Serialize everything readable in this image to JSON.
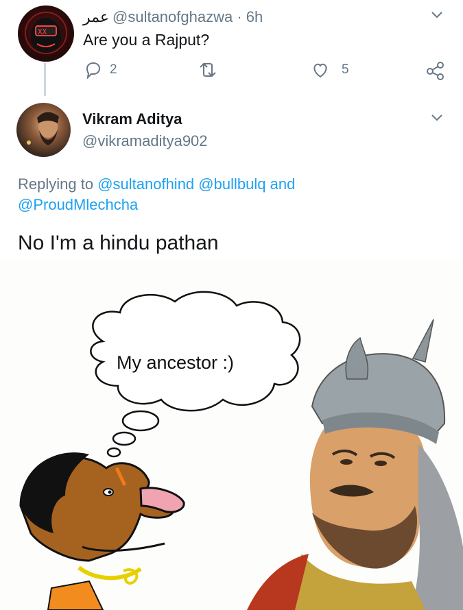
{
  "tweet1": {
    "display_name": "عمر",
    "handle_time": "@sultanofghazwa · 6h",
    "text": "Are you a Rajput?",
    "reply_count": "2",
    "like_count": "5",
    "icons": [
      "reply-icon",
      "retweet-icon",
      "like-icon",
      "share-icon",
      "chevron-down-icon"
    ]
  },
  "tweet2": {
    "display_name": "Vikram Aditya",
    "handle": "@vikramaditya902",
    "replying_prefix": "Replying to ",
    "mention_1": "@sultanofhind",
    "mention_2": "@bullbulq",
    "replying_and": " and",
    "mention_3": "@ProudMlechcha",
    "text": "No I'm a hindu pathan"
  },
  "meme": {
    "thought_bubble_text": "My ancestor :)"
  },
  "colors": {
    "text": "#14171a",
    "secondary": "#657786",
    "link": "#1da1f2",
    "divider": "#ccd6dd"
  }
}
